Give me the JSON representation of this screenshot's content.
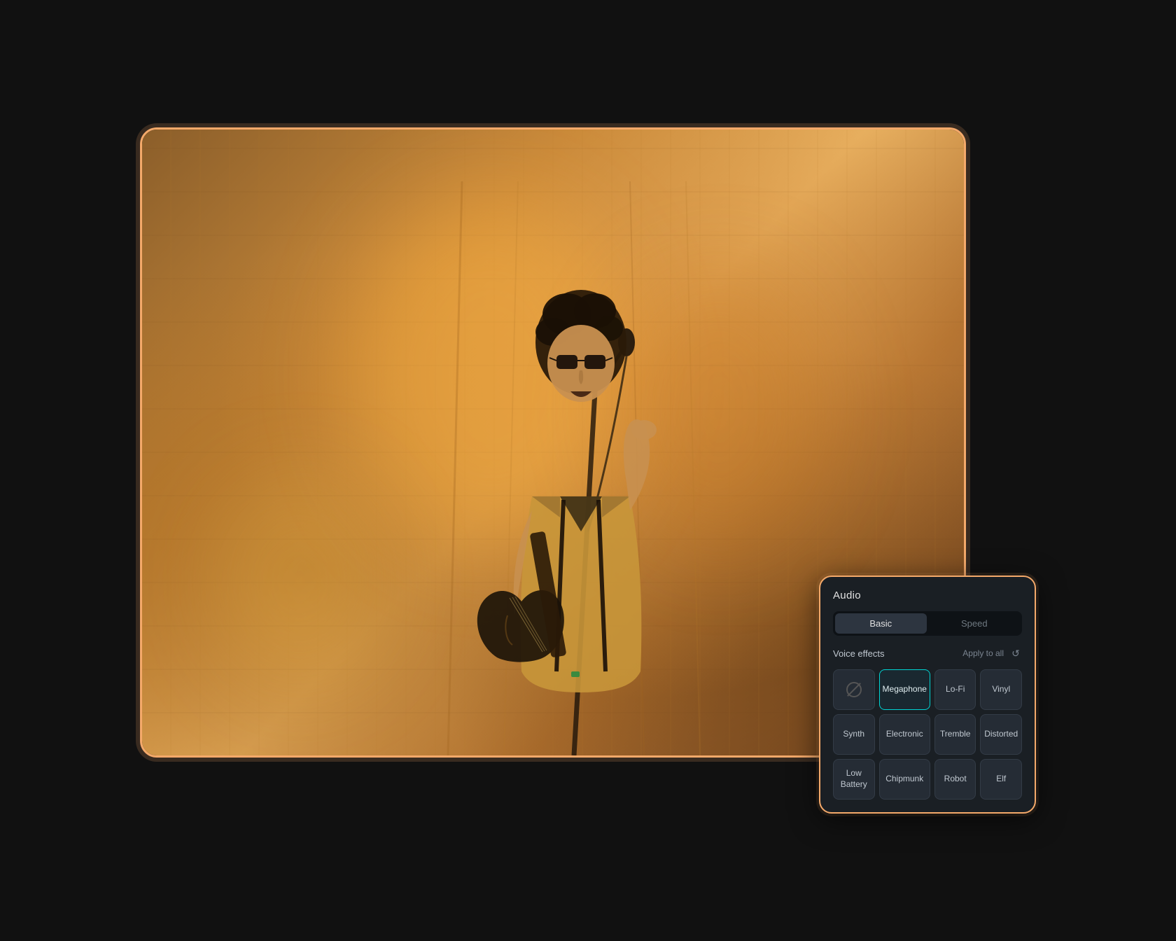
{
  "scene": {
    "background": "#111"
  },
  "photo": {
    "alt": "Singer performing on stage with guitar, warm orange lighting"
  },
  "audio_panel": {
    "title": "Audio",
    "tabs": [
      {
        "id": "basic",
        "label": "Basic",
        "active": true
      },
      {
        "id": "speed",
        "label": "Speed",
        "active": false
      }
    ],
    "voice_effects": {
      "section_label": "Voice effects",
      "apply_all_label": "Apply to all",
      "reset_tooltip": "Reset",
      "effects": [
        {
          "id": "none",
          "label": "",
          "is_none": true,
          "selected": false
        },
        {
          "id": "megaphone",
          "label": "Megaphone",
          "selected": true
        },
        {
          "id": "lofi",
          "label": "Lo-Fi",
          "selected": false
        },
        {
          "id": "vinyl",
          "label": "Vinyl",
          "selected": false
        },
        {
          "id": "synth",
          "label": "Synth",
          "selected": false
        },
        {
          "id": "electronic",
          "label": "Electronic",
          "selected": false
        },
        {
          "id": "tremble",
          "label": "Tremble",
          "selected": false
        },
        {
          "id": "distorted",
          "label": "Distorted",
          "selected": false
        },
        {
          "id": "low_battery",
          "label": "Low Battery",
          "selected": false
        },
        {
          "id": "chipmunk",
          "label": "Chipmunk",
          "selected": false
        },
        {
          "id": "robot",
          "label": "Robot",
          "selected": false
        },
        {
          "id": "elf",
          "label": "Elf",
          "selected": false
        }
      ]
    }
  }
}
